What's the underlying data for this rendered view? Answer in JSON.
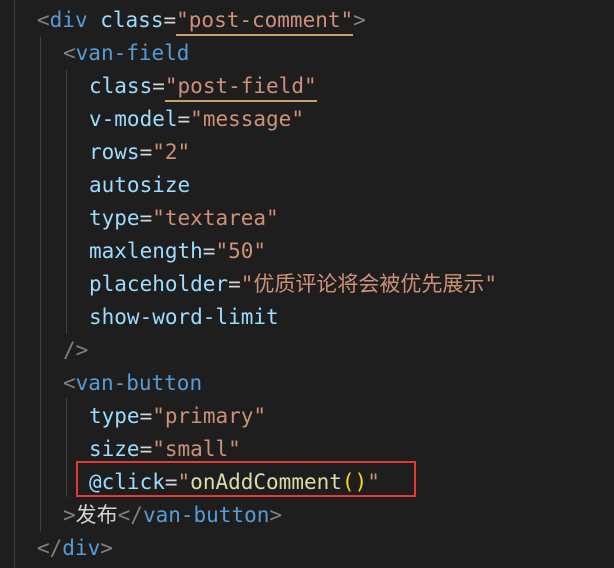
{
  "code": {
    "l1": {
      "tag": "div",
      "attr": "class",
      "value": "post-comment"
    },
    "l2": {
      "tag": "van-field"
    },
    "l3": {
      "attr": "class",
      "value": "post-field"
    },
    "l4": {
      "attr": "v-model",
      "value": "message"
    },
    "l5": {
      "attr": "rows",
      "value": "2"
    },
    "l6": {
      "attr": "autosize"
    },
    "l7": {
      "attr": "type",
      "value": "textarea"
    },
    "l8": {
      "attr": "maxlength",
      "value": "50"
    },
    "l9": {
      "attr": "placeholder",
      "value": "优质评论将会被优先展示"
    },
    "l10": {
      "attr": "show-word-limit"
    },
    "l11": {
      "text": "/>"
    },
    "l12": {
      "tag": "van-button"
    },
    "l13": {
      "attr": "type",
      "value": "primary"
    },
    "l14": {
      "attr": "size",
      "value": "small"
    },
    "l15": {
      "attr": "@click",
      "fn": "onAddComment",
      "parens": "()"
    },
    "l16": {
      "text": "发布",
      "close_tag": "van-button"
    },
    "l17": {
      "close_tag": "div"
    }
  },
  "colors": {
    "tag": "#569cd6",
    "attribute": "#9cdcfe",
    "string": "#ce9178",
    "function": "#dcdcaa",
    "highlight_border": "#e53935"
  }
}
